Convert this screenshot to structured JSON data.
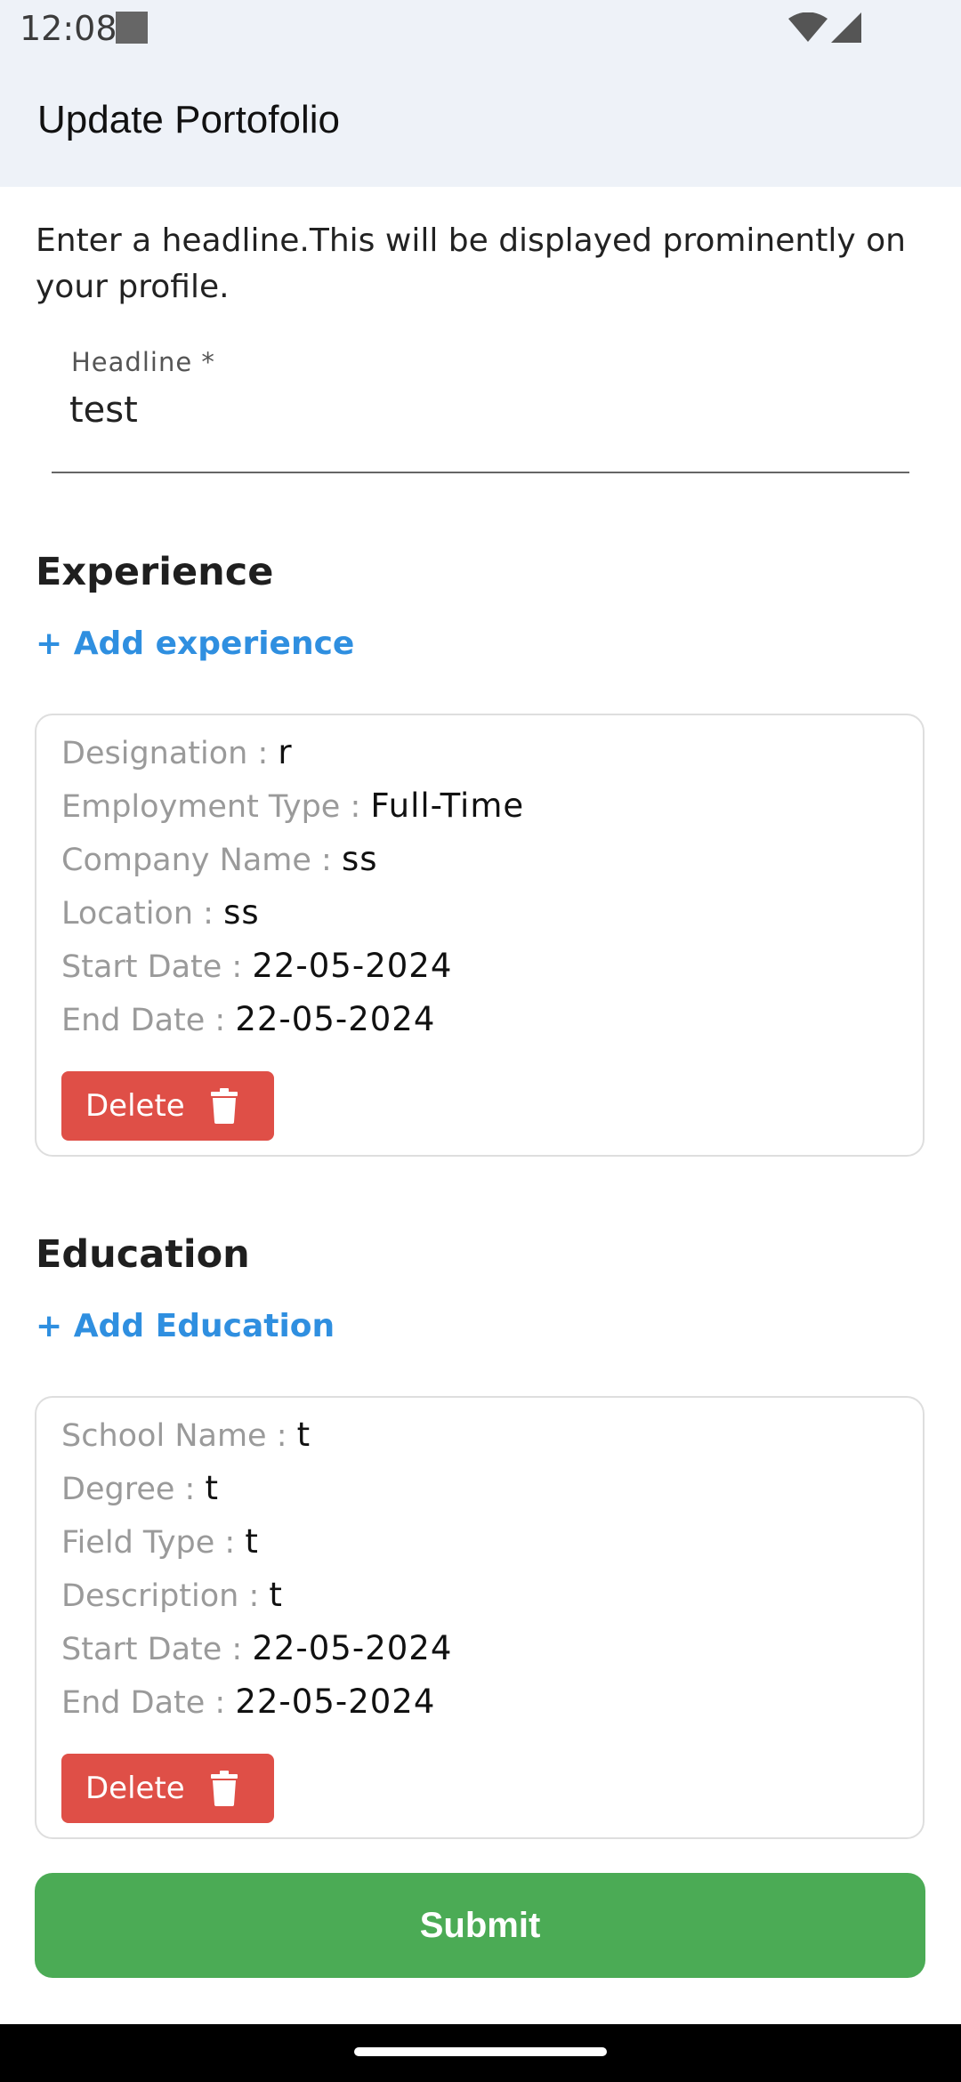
{
  "status_bar": {
    "time": "12:08"
  },
  "app_bar": {
    "title": "Update Portofolio"
  },
  "intro": {
    "text": "Enter a headline.This will be displayed prominently on your profile."
  },
  "headline": {
    "label": "Headline *",
    "value": "test"
  },
  "experience": {
    "title": "Experience",
    "add_label": "+ Add experience",
    "items": [
      {
        "rows": [
          {
            "label": "Designation : ",
            "value": "r"
          },
          {
            "label": "Employment Type : ",
            "value": "Full-Time"
          },
          {
            "label": "Company Name : ",
            "value": "ss"
          },
          {
            "label": "Location : ",
            "value": "ss"
          },
          {
            "label": "Start Date : ",
            "value": "22-05-2024"
          },
          {
            "label": "End Date : ",
            "value": "22-05-2024"
          }
        ],
        "delete_label": "Delete"
      }
    ]
  },
  "education": {
    "title": "Education",
    "add_label": "+ Add Education",
    "items": [
      {
        "rows": [
          {
            "label": "School Name : ",
            "value": "t"
          },
          {
            "label": "Degree : ",
            "value": "t"
          },
          {
            "label": "Field Type : ",
            "value": "t"
          },
          {
            "label": "Description : ",
            "value": "t"
          },
          {
            "label": "Start Date : ",
            "value": "22-05-2024"
          },
          {
            "label": "End Date : ",
            "value": "22-05-2024"
          }
        ],
        "delete_label": "Delete"
      }
    ]
  },
  "submit": {
    "label": "Submit"
  },
  "colors": {
    "accent_link": "#2f8fe0",
    "delete": "#df4f47",
    "submit": "#4bab55"
  },
  "icons": {
    "status_wifi": "wifi-icon",
    "status_signal": "signal-icon",
    "delete": "trash-icon"
  }
}
